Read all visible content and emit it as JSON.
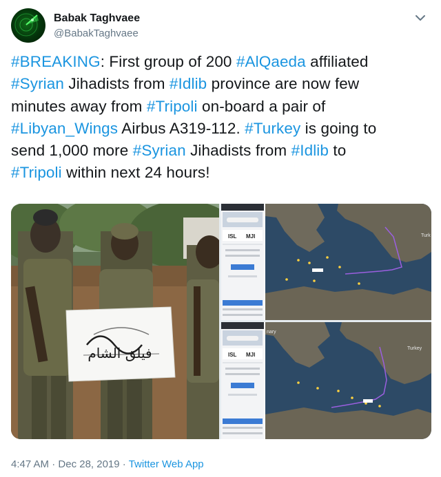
{
  "author": {
    "display_name": "Babak Taghvaee",
    "handle": "@BabakTaghvaee",
    "avatar_icon": "radar-avatar-icon"
  },
  "tweet": {
    "lines": [
      [
        {
          "text": "#BREAKING",
          "tag": true
        },
        {
          "text": ": First group of 200 ",
          "tag": false
        },
        {
          "text": "#AlQaeda",
          "tag": true
        },
        {
          "text": " affiliated",
          "tag": false
        }
      ],
      [
        {
          "text": "#Syrian",
          "tag": true
        },
        {
          "text": " Jihadists from ",
          "tag": false
        },
        {
          "text": "#Idlib",
          "tag": true
        },
        {
          "text": " province are now few",
          "tag": false
        }
      ],
      [
        {
          "text": "minutes away from ",
          "tag": false
        },
        {
          "text": "#Tripoli",
          "tag": true
        },
        {
          "text": " on-board a pair of",
          "tag": false
        }
      ],
      [
        {
          "text": "#Libyan_Wings",
          "tag": true
        },
        {
          "text": " Airbus A319-112. ",
          "tag": false
        },
        {
          "text": "#Turkey",
          "tag": true
        },
        {
          "text": " is going to",
          "tag": false
        }
      ],
      [
        {
          "text": "send 1,000 more ",
          "tag": false
        },
        {
          "text": "#Syrian",
          "tag": true
        },
        {
          "text": " Jihadists from ",
          "tag": false
        },
        {
          "text": "#Idlib",
          "tag": true
        },
        {
          "text": " to",
          "tag": false
        }
      ],
      [
        {
          "text": "#Tripoli",
          "tag": true
        },
        {
          "text": " within next 24 hours!",
          "tag": false
        }
      ]
    ]
  },
  "media": {
    "left_photo": {
      "flag_text": "فيلق الشام"
    },
    "right_top": {
      "origin_code": "ISL",
      "dest_code": "MJI",
      "map_label_1": "Turk"
    },
    "right_bottom": {
      "origin_code": "ISL",
      "dest_code": "MJI",
      "map_label_1": "Turkey",
      "map_label_2": "nary"
    }
  },
  "footer": {
    "time": "4:47 AM",
    "separator_1": " · ",
    "date": "Dec 28, 2019",
    "separator_2": " · ",
    "source": "Twitter Web App"
  },
  "colors": {
    "link": "#1b95e0",
    "text": "#14171a",
    "muted": "#657786"
  }
}
